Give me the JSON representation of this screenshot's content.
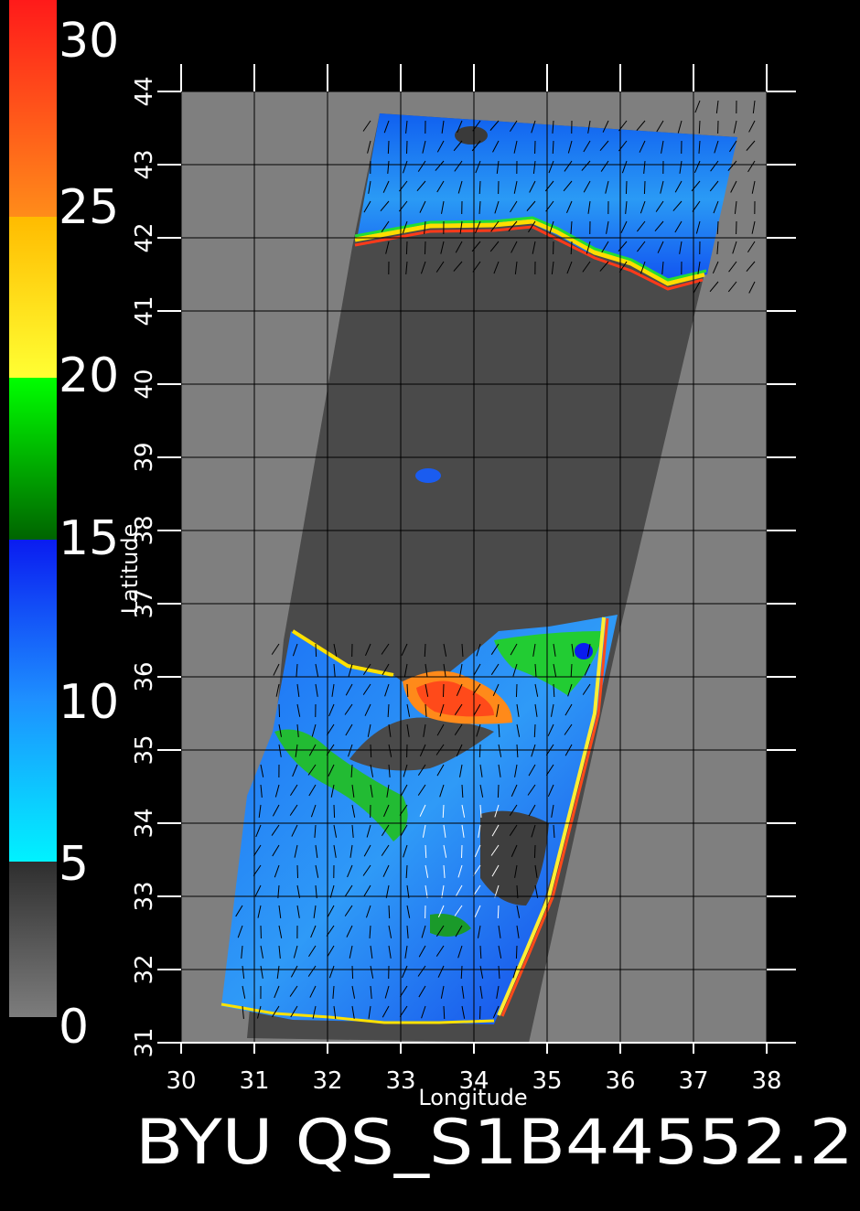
{
  "product_id": "BYU QS_S1B44552.2",
  "x_axis": {
    "label": "Longitude",
    "ticks": [
      "30",
      "31",
      "32",
      "33",
      "34",
      "35",
      "36",
      "37",
      "38"
    ],
    "range": [
      30,
      38
    ]
  },
  "y_axis": {
    "label": "Latitude",
    "ticks": [
      "31",
      "32",
      "33",
      "34",
      "35",
      "36",
      "37",
      "38",
      "39",
      "40",
      "41",
      "42",
      "43",
      "44"
    ],
    "range": [
      31,
      44
    ]
  },
  "colorbar": {
    "tick_labels": [
      "0",
      "5",
      "10",
      "15",
      "20",
      "25",
      "30"
    ],
    "range": [
      0,
      30
    ],
    "segments": [
      {
        "from": 0,
        "to": 5,
        "colors": [
          "#7d7d7d",
          "#2e2e2e"
        ]
      },
      {
        "from": 5,
        "to": 10,
        "colors": [
          "#00f2ff",
          "#1e90ff"
        ]
      },
      {
        "from": 10,
        "to": 15,
        "colors": [
          "#1e90ff",
          "#0a1cf0"
        ]
      },
      {
        "from": 15,
        "to": 20,
        "colors": [
          "#006400",
          "#00ff00"
        ]
      },
      {
        "from": 20,
        "to": 25,
        "colors": [
          "#ffff33",
          "#ffbb00"
        ]
      },
      {
        "from": 25,
        "to": 30,
        "colors": [
          "#ff8c1a",
          "#ff1a1a"
        ]
      }
    ]
  },
  "colors": {
    "background": "#000000",
    "map_fill": "#7f7f7f",
    "land_mask": "#4a4a4a",
    "grid": "#000000",
    "tick_text": "#ffffff"
  }
}
